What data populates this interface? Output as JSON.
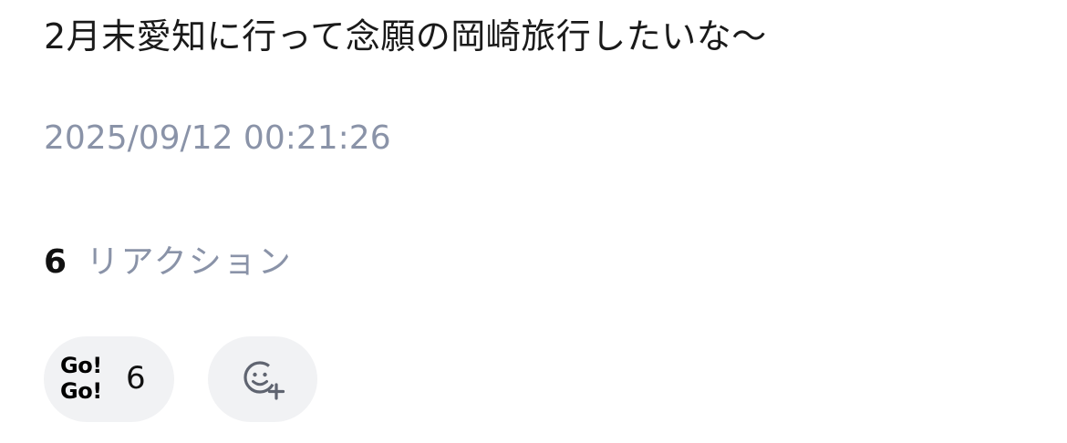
{
  "post": {
    "text": "2月末愛知に行って念願の岡崎旅行したいな〜",
    "timestamp": "2025/09/12 00:21:26"
  },
  "reactions": {
    "total": "6",
    "label": "リアクション",
    "items": [
      {
        "logo_lines": [
          "Go!",
          "Go!"
        ],
        "count": "6"
      }
    ],
    "add_icon": "emoji-add-icon"
  },
  "colors": {
    "text": "#1a1a1a",
    "muted": "#8a93a8",
    "chip_bg": "#f1f2f4"
  }
}
